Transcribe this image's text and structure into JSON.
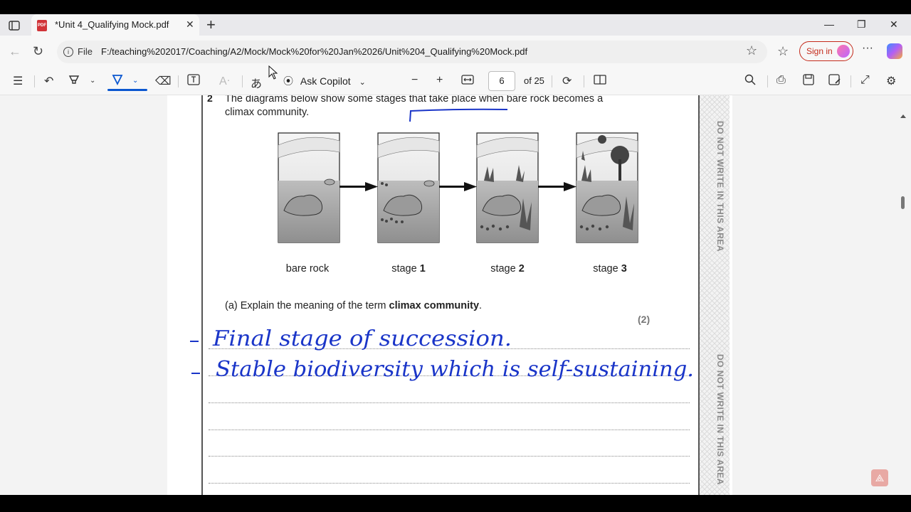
{
  "tab": {
    "title": "*Unit 4_Qualifying Mock.pdf",
    "pdf_badge": "PDF"
  },
  "address": {
    "file_label": "File",
    "url": "F:/teaching%202017/Coaching/A2/Mock/Mock%20for%20Jan%2026/Unit%204_Qualifying%20Mock.pdf"
  },
  "profile": {
    "sign_in_label": "Sign in"
  },
  "toolbar": {
    "ask_copilot": "Ask Copilot",
    "page_number": "6",
    "page_of": "of 25"
  },
  "document": {
    "question_number": "2",
    "question_text": "The diagrams below show some stages that take place when bare rock becomes a climax community.",
    "captions": [
      {
        "plain": "bare rock",
        "bold": ""
      },
      {
        "plain": "stage ",
        "bold": "1"
      },
      {
        "plain": "stage ",
        "bold": "2"
      },
      {
        "plain": "stage ",
        "bold": "3"
      }
    ],
    "part_a_prefix": "(a)  Explain the meaning of the term ",
    "part_a_term": "climax community",
    "part_a_suffix": ".",
    "marks": "(2)",
    "margin_note": "DO NOT WRITE IN THIS AREA",
    "handwriting": [
      "Final stage of succession.",
      "Stable biodiversity which is self-sustaining."
    ]
  },
  "colors": {
    "ink": "#1a35c8",
    "accent": "#0b57d0",
    "signin": "#c42b1c"
  }
}
